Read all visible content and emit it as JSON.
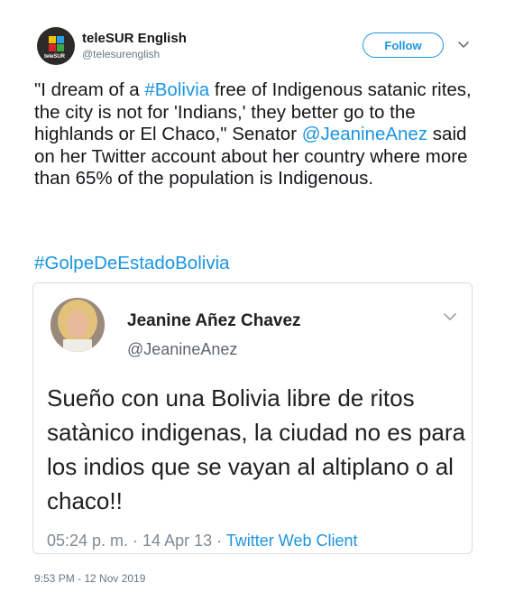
{
  "header": {
    "display_name": "teleSUR English",
    "handle": "@telesurenglish",
    "avatar_text": "teleSUR",
    "follow_label": "Follow"
  },
  "tweet": {
    "text_part1": "\"I dream of a ",
    "hashtag_bolivia": "#Bolivia",
    "text_part2": " free of Indigenous satanic rites, the city is not for 'Indians,' they better go to the highlands or El Chaco,\" Senator ",
    "mention": "@JeanineAnez",
    "text_part3": " said on her Twitter account about her country where more than 65% of the population is Indigenous.",
    "hashtag": "#GolpeDeEstadoBolivia",
    "timestamp": "9:53 PM - 12 Nov 2019"
  },
  "quoted": {
    "display_name": "Jeanine Añez Chavez",
    "handle": "@JeanineAnez",
    "text": "Sueño con una Bolivia libre de ritos satànico indigenas, la ciudad no es para los indios que se vayan al altiplano o al chaco!!",
    "meta": "05:24 p. m. · 14 Apr 13 · ",
    "client": "Twitter Web Client"
  },
  "colors": {
    "link": "#1b95e0",
    "text": "#14171a",
    "secondary": "#657786"
  },
  "icons": {
    "caret": "chevron-down-icon"
  }
}
